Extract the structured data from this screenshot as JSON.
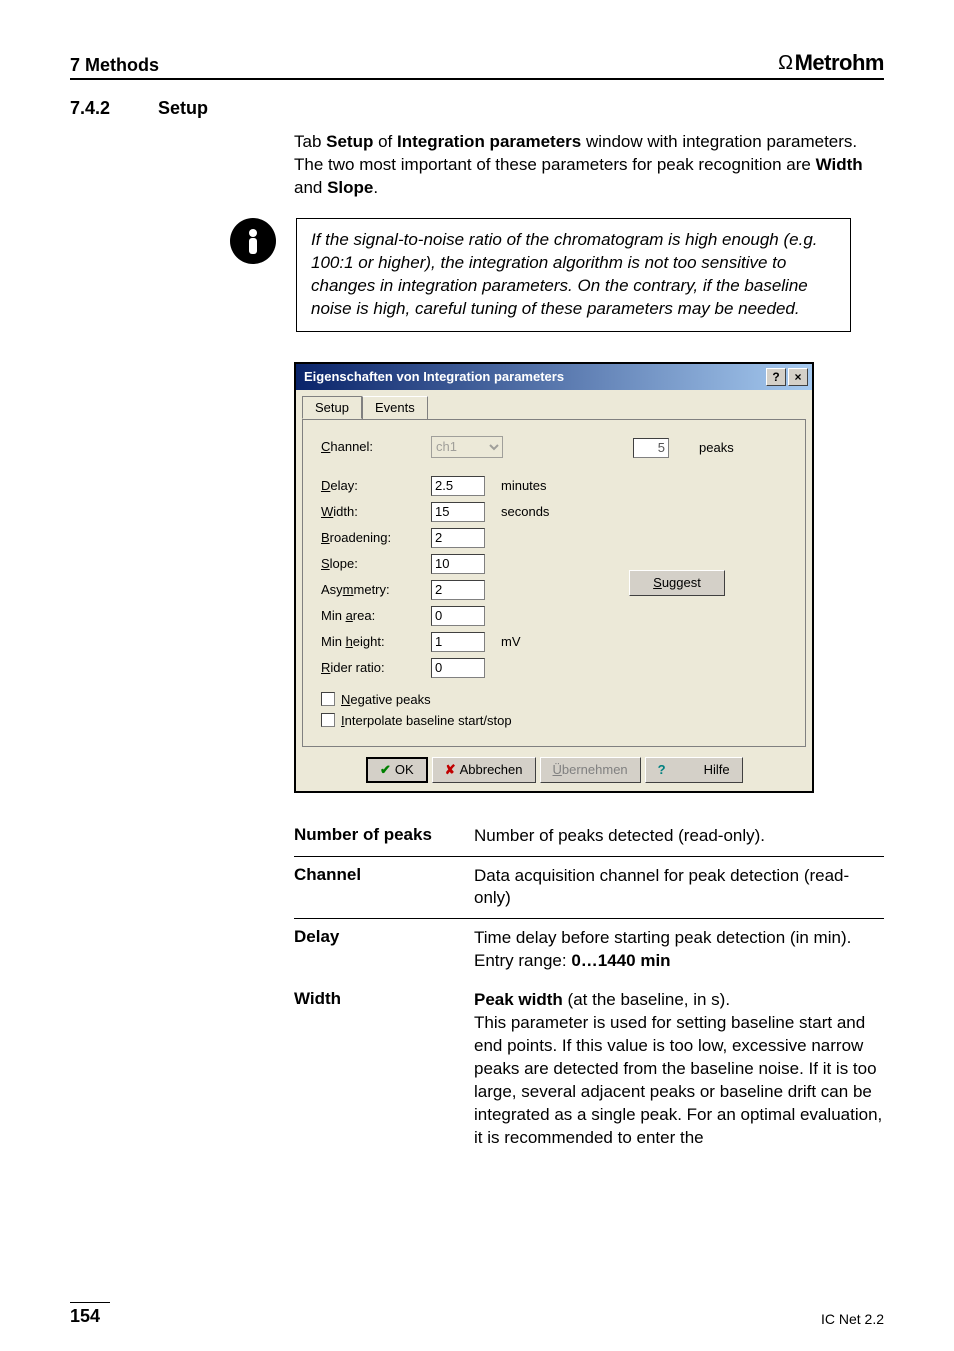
{
  "header": {
    "chapter": "7  Methods",
    "brand_prefix": "Ω",
    "brand": "Metrohm"
  },
  "section": {
    "number": "7.4.2",
    "title": "Setup"
  },
  "intro": {
    "text_before_setup": "Tab ",
    "setup_bold": "Setup",
    "text_mid1": " of ",
    "ip_bold": "Integration parameters",
    "text_mid2": " window with integration parameters. The two most important of these parameters for peak recognition are ",
    "width_bold": "Width",
    "text_and": " and ",
    "slope_bold": "Slope",
    "text_end": "."
  },
  "info_box": "If the signal-to-noise ratio of the chromatogram is high enough (e.g. 100:1 or higher), the integration algorithm is not too sensitive to changes in integration parameters. On the contrary, if the baseline noise is high, careful tuning of these parameters may be needed.",
  "dialog": {
    "title": "Eigenschaften von Integration parameters",
    "help_btn": "?",
    "close_btn": "×",
    "tabs": {
      "setup": "Setup",
      "events": "Events"
    },
    "labels": {
      "channel": "Channel:",
      "delay": "Delay:",
      "width": "Width:",
      "broadening": "Broadening:",
      "slope": "Slope:",
      "asymmetry": "Asymmetry:",
      "min_area": "Min area:",
      "min_height": "Min height:",
      "rider_ratio": "Rider ratio:",
      "peaks": "peaks",
      "negative_peaks": "Negative peaks",
      "interpolate": "Interpolate baseline start/stop"
    },
    "values": {
      "channel": "ch1",
      "delay": "2.5",
      "width": "15",
      "broadening": "2",
      "slope": "10",
      "asymmetry": "2",
      "min_area": "0",
      "min_height": "1",
      "rider_ratio": "0",
      "peaks_count": "5"
    },
    "units": {
      "delay": "minutes",
      "width": "seconds",
      "min_height": "mV"
    },
    "buttons": {
      "suggest": "Suggest",
      "ok": "OK",
      "cancel": "Abbrechen",
      "apply": "Übernehmen",
      "help": "Hilfe"
    }
  },
  "definitions": [
    {
      "term": "Number of peaks",
      "desc_plain": "Number of peaks detected (read-only)."
    },
    {
      "term": "Channel",
      "desc_plain": "Data acquisition channel for peak detection (read-only)"
    },
    {
      "term": "Delay",
      "desc_line1": "Time delay before starting peak detection (in min).",
      "desc_range_label": "Entry range:  ",
      "desc_range_value": "0…1440 min"
    },
    {
      "term": "Width",
      "desc_bold_lead": "Peak width",
      "desc_rest": " (at the baseline, in s).\nThis parameter is used for setting baseline start and end points. If this value is too low, excessive narrow peaks are detected from the baseline noise. If it is too large, several adjacent peaks or baseline drift can be integrated as a single peak. For an optimal evaluation, it is recommended to enter the"
    }
  ],
  "footer": {
    "page": "154",
    "product": "IC Net 2.2"
  }
}
